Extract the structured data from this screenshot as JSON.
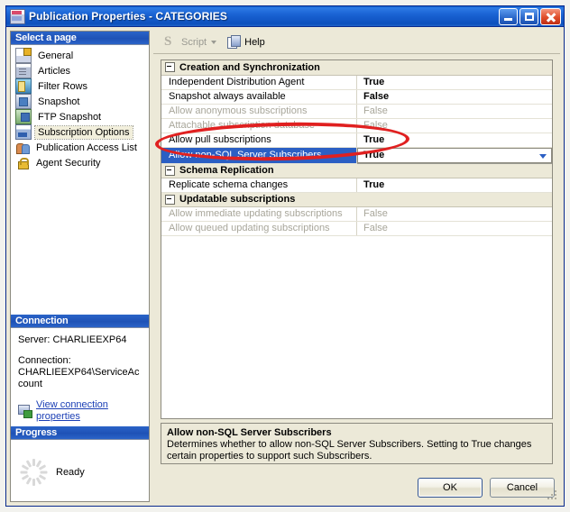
{
  "window": {
    "title": "Publication Properties - CATEGORIES",
    "icon": "publication-icon",
    "minimize_label": "Minimize",
    "maximize_label": "Maximize",
    "close_label": "Close"
  },
  "sidebar": {
    "header": "Select a page",
    "items": [
      {
        "label": "General",
        "icon": "general-icon"
      },
      {
        "label": "Articles",
        "icon": "articles-icon"
      },
      {
        "label": "Filter Rows",
        "icon": "filter-rows-icon"
      },
      {
        "label": "Snapshot",
        "icon": "snapshot-icon"
      },
      {
        "label": "FTP Snapshot",
        "icon": "ftp-snapshot-icon"
      },
      {
        "label": "Subscription Options",
        "icon": "subscription-options-icon",
        "selected": true
      },
      {
        "label": "Publication Access List",
        "icon": "publication-access-list-icon"
      },
      {
        "label": "Agent Security",
        "icon": "agent-security-icon"
      }
    ],
    "connection": {
      "header": "Connection",
      "server_line": "Server: CHARLIEEXP64",
      "connection_label": "Connection:",
      "connection_value": "CHARLIEEXP64\\ServiceAccount",
      "link": "View connection properties"
    },
    "progress": {
      "header": "Progress",
      "status": "Ready"
    }
  },
  "toolbar": {
    "script_label": "Script",
    "help_label": "Help"
  },
  "grid": {
    "groups": [
      {
        "name": "Creation and Synchronization",
        "rows": [
          {
            "name": "Independent Distribution Agent",
            "value": "True",
            "disabled": false
          },
          {
            "name": "Snapshot always available",
            "value": "False",
            "disabled": false
          },
          {
            "name": "Allow anonymous subscriptions",
            "value": "False",
            "disabled": true
          },
          {
            "name": "Attachable subscription database",
            "value": "False",
            "disabled": true
          },
          {
            "name": "Allow pull subscriptions",
            "value": "True",
            "disabled": false
          },
          {
            "name": "Allow non-SQL Server Subscribers",
            "value": "True",
            "disabled": false,
            "selected": true,
            "editor": "dropdown"
          }
        ]
      },
      {
        "name": "Schema Replication",
        "rows": [
          {
            "name": "Replicate schema changes",
            "value": "True",
            "disabled": false
          }
        ]
      },
      {
        "name": "Updatable subscriptions",
        "rows": [
          {
            "name": "Allow immediate updating subscriptions",
            "value": "False",
            "disabled": true
          },
          {
            "name": "Allow queued updating subscriptions",
            "value": "False",
            "disabled": true
          }
        ]
      }
    ]
  },
  "description": {
    "title": "Allow non-SQL Server Subscribers",
    "body": "Determines whether to allow non-SQL Server Subscribers. Setting to True changes certain properties to support such Subscribers."
  },
  "buttons": {
    "ok": "OK",
    "cancel": "Cancel"
  },
  "annotation": {
    "shape": "red-ellipse-highlight",
    "color": "#e02020"
  }
}
